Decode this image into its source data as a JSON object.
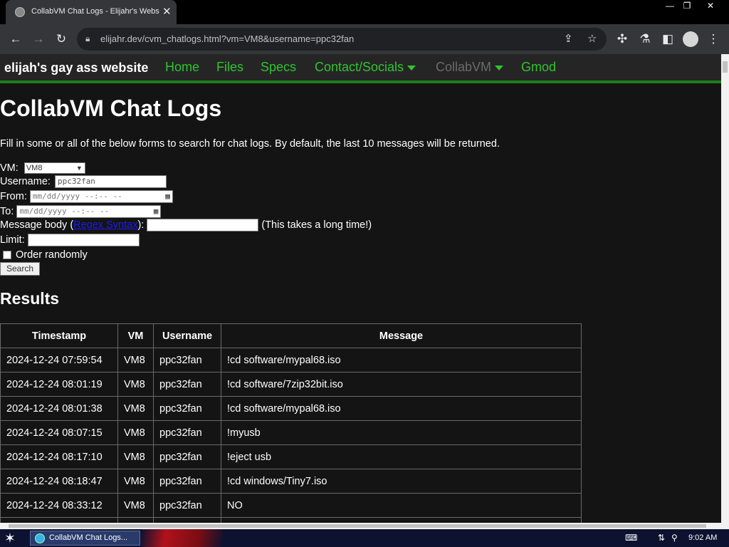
{
  "browser": {
    "tab_title": "CollabVM Chat Logs - Elijahr's Webs",
    "tab_close": "✕",
    "url": "elijahr.dev/cvm_chatlogs.html?vm=VM8&username=ppc32fan",
    "window_minimize": "—",
    "window_restore": "❐",
    "window_close": "✕"
  },
  "site": {
    "brand": "elijah's gay ass website",
    "nav": [
      {
        "label": "Home"
      },
      {
        "label": "Files"
      },
      {
        "label": "Specs"
      },
      {
        "label": "Contact/Socials"
      },
      {
        "label": "CollabVM"
      },
      {
        "label": "Gmod"
      }
    ]
  },
  "page": {
    "title": "CollabVM Chat Logs",
    "intro": "Fill in some or all of the below forms to search for chat logs. By default, the last 10 messages will be returned.",
    "form": {
      "vm_label": "VM:",
      "vm_value": "VM8",
      "username_label": "Username:",
      "username_value": "ppc32fan",
      "from_label": "From:",
      "from_placeholder": "mm/dd/yyyy --:-- --",
      "to_label": "To:",
      "to_placeholder": "mm/dd/yyyy --:-- --",
      "message_label": "Message body (",
      "message_link": "Regex Syntax",
      "message_label_close": "):",
      "message_note": "(This takes a long time!)",
      "limit_label": "Limit:",
      "random_label": "Order randomly",
      "search_button": "Search"
    },
    "results_title": "Results",
    "table": {
      "headers": [
        "Timestamp",
        "VM",
        "Username",
        "Message"
      ],
      "rows": [
        [
          "2024-12-24 07:59:54",
          "VM8",
          "ppc32fan",
          "!cd software/mypal68.iso"
        ],
        [
          "2024-12-24 08:01:19",
          "VM8",
          "ppc32fan",
          "!cd software/7zip32bit.iso"
        ],
        [
          "2024-12-24 08:01:38",
          "VM8",
          "ppc32fan",
          "!cd software/mypal68.iso"
        ],
        [
          "2024-12-24 08:07:15",
          "VM8",
          "ppc32fan",
          "!myusb"
        ],
        [
          "2024-12-24 08:17:10",
          "VM8",
          "ppc32fan",
          "!eject usb"
        ],
        [
          "2024-12-24 08:18:47",
          "VM8",
          "ppc32fan",
          "!cd windows/Tiny7.iso"
        ],
        [
          "2024-12-24 08:33:12",
          "VM8",
          "ppc32fan",
          "NO"
        ]
      ]
    }
  },
  "taskbar": {
    "task_label": "CollabVM Chat Logs...",
    "clock": "9:02 AM"
  }
}
